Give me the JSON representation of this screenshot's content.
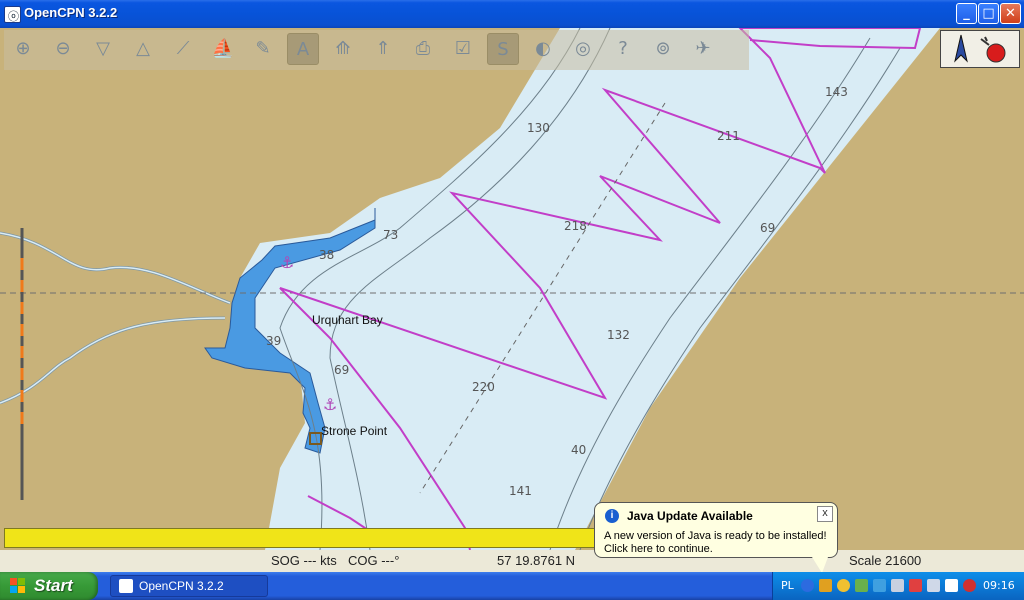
{
  "window": {
    "title": "OpenCPN 3.2.2",
    "minimize_label": "_",
    "maximize_label": "□",
    "close_label": "✕"
  },
  "toolbar": {
    "tools": [
      {
        "name": "zoom-in-icon",
        "glyph": "⊕"
      },
      {
        "name": "zoom-out-icon",
        "glyph": "⊖"
      },
      {
        "name": "scale-down-icon",
        "glyph": "▽"
      },
      {
        "name": "scale-up-icon",
        "glyph": "△"
      },
      {
        "name": "route-icon",
        "glyph": "⟋"
      },
      {
        "name": "auto-follow-icon",
        "glyph": "⛵"
      },
      {
        "name": "settings-icon",
        "glyph": "✎"
      },
      {
        "name": "text-icon",
        "glyph": "A"
      },
      {
        "name": "current-icon",
        "glyph": "⟰"
      },
      {
        "name": "tide-icon",
        "glyph": "⇑"
      },
      {
        "name": "print-icon",
        "glyph": "⎙"
      },
      {
        "name": "route-manager-icon",
        "glyph": "☑"
      },
      {
        "name": "track-icon",
        "glyph": "S"
      },
      {
        "name": "color-scheme-icon",
        "glyph": "◐"
      },
      {
        "name": "mob-icon",
        "glyph": "◎"
      },
      {
        "name": "help-icon",
        "glyph": "?"
      },
      {
        "name": "ais-icon",
        "glyph": "⊚"
      },
      {
        "name": "plugin-icon",
        "glyph": "✈"
      }
    ]
  },
  "chart": {
    "labels": {
      "urquhart_bay": "Urquhart Bay",
      "strone_point": "Strone Point"
    },
    "soundings": [
      "143",
      "130",
      "211",
      "218",
      "69",
      "73",
      "38",
      "39",
      "69",
      "132",
      "220",
      "40",
      "141"
    ],
    "colors": {
      "land": "#c8b27a",
      "water": "#d9ecf5",
      "shallow": "#4a9ae2",
      "route": "#c23ec8"
    }
  },
  "status": {
    "sog": "SOG --- kts",
    "cog": "COG ---°",
    "position": "57 19.8761 N",
    "scale": "Scale 21600"
  },
  "notification": {
    "title": "Java Update Available",
    "line1": "A new version of Java is ready to be installed!",
    "line2": "Click here to continue.",
    "close_label": "x"
  },
  "taskbar": {
    "start_label": "Start",
    "task_label": "OpenCPN 3.2.2",
    "lang": "PL",
    "clock": "09:16"
  }
}
